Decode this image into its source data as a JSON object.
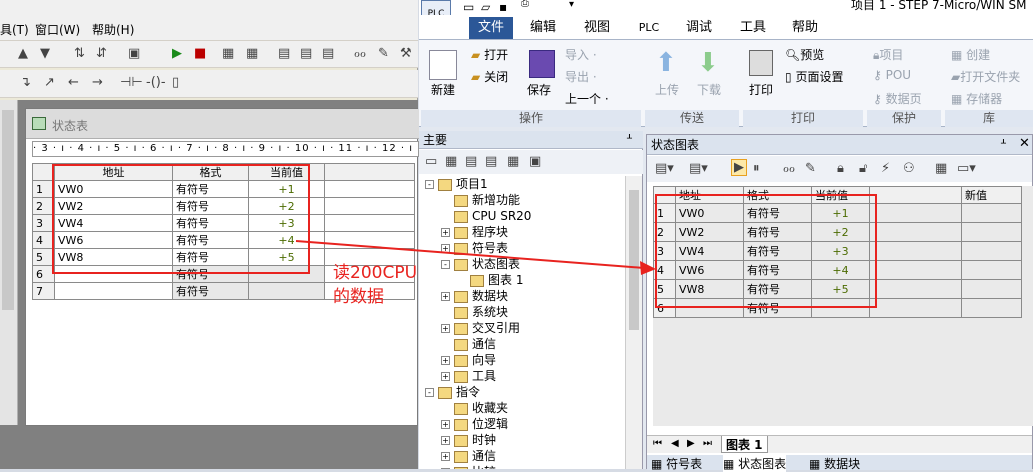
{
  "left_app": {
    "menu": [
      "具(T)",
      "窗口(W)",
      "帮助(H)"
    ],
    "window_title": "状态表",
    "ruler": "· 3 · ı · 4 · ı · 5 · ı · 6 · ı · 7 · ı · 8 · ı · 9 · ı · 10 · ı · 11 · ı · 12 · ı",
    "columns": [
      "",
      "地址",
      "格式",
      "当前值"
    ],
    "rows": [
      {
        "num": "1",
        "address": "VW0",
        "format": "有符号",
        "value": "+1"
      },
      {
        "num": "2",
        "address": "VW2",
        "format": "有符号",
        "value": "+2"
      },
      {
        "num": "3",
        "address": "VW4",
        "format": "有符号",
        "value": "+3"
      },
      {
        "num": "4",
        "address": "VW6",
        "format": "有符号",
        "value": "+4"
      },
      {
        "num": "5",
        "address": "VW8",
        "format": "有符号",
        "value": "+5"
      },
      {
        "num": "6",
        "address": "",
        "format": "有符号",
        "value": ""
      },
      {
        "num": "7",
        "address": "",
        "format": "有符号",
        "value": ""
      }
    ]
  },
  "annotation": {
    "line1": "读200CPU",
    "line2": "的数据"
  },
  "right_app": {
    "title": "项目 1 - STEP 7-Micro/WIN SM",
    "tabs": [
      "文件",
      "编辑",
      "视图",
      "PLC",
      "调试",
      "工具",
      "帮助"
    ],
    "ribbon": {
      "new": "新建",
      "open": "打开",
      "close": "关闭",
      "save": "保存",
      "import": "导入 ·",
      "export": "导出 ·",
      "prev": "上一个 ·",
      "upload": "上传",
      "download": "下载",
      "print": "打印",
      "preview": "预览",
      "page_setup": "页面设置",
      "project": "项目",
      "pou": "POU",
      "data_page": "数据页",
      "create": "创建",
      "open_folder": "打开文件夹",
      "storage": "存储器",
      "groups": [
        "操作",
        "传送",
        "打印",
        "保护",
        "库"
      ]
    },
    "tree": {
      "title": "主要",
      "items": [
        {
          "label": "项目1",
          "level": 0,
          "expand": "-"
        },
        {
          "label": "新增功能",
          "level": 1,
          "expand": ""
        },
        {
          "label": "CPU SR20",
          "level": 1,
          "expand": ""
        },
        {
          "label": "程序块",
          "level": 1,
          "expand": "+"
        },
        {
          "label": "符号表",
          "level": 1,
          "expand": "+"
        },
        {
          "label": "状态图表",
          "level": 1,
          "expand": "-"
        },
        {
          "label": "图表 1",
          "level": 2,
          "expand": ""
        },
        {
          "label": "数据块",
          "level": 1,
          "expand": "+"
        },
        {
          "label": "系统块",
          "level": 1,
          "expand": ""
        },
        {
          "label": "交叉引用",
          "level": 1,
          "expand": "+"
        },
        {
          "label": "通信",
          "level": 1,
          "expand": ""
        },
        {
          "label": "向导",
          "level": 1,
          "expand": "+"
        },
        {
          "label": "工具",
          "level": 1,
          "expand": "+"
        },
        {
          "label": "指令",
          "level": 0,
          "expand": "-"
        },
        {
          "label": "收藏夹",
          "level": 1,
          "expand": ""
        },
        {
          "label": "位逻辑",
          "level": 1,
          "expand": "+"
        },
        {
          "label": "时钟",
          "level": 1,
          "expand": "+"
        },
        {
          "label": "通信",
          "level": 1,
          "expand": "+"
        },
        {
          "label": "比较",
          "level": 1,
          "expand": "+"
        }
      ]
    },
    "chart": {
      "title": "状态图表",
      "columns": [
        "",
        "地址",
        "格式",
        "当前值",
        "新值"
      ],
      "rows": [
        {
          "num": "1",
          "address": "VW0",
          "format": "有符号",
          "value": "+1"
        },
        {
          "num": "2",
          "address": "VW2",
          "format": "有符号",
          "value": "+2"
        },
        {
          "num": "3",
          "address": "VW4",
          "format": "有符号",
          "value": "+3"
        },
        {
          "num": "4",
          "address": "VW6",
          "format": "有符号",
          "value": "+4"
        },
        {
          "num": "5",
          "address": "VW8",
          "format": "有符号",
          "value": "+5"
        },
        {
          "num": "6",
          "address": "",
          "format": "有符号",
          "value": ""
        }
      ],
      "sheet_tab": "图表 1",
      "bottom_tabs": [
        "符号表",
        "状态图表",
        "数据块"
      ]
    }
  },
  "colors": {
    "annotation": "#e8231f",
    "value": "#4b6b00",
    "accent": "#2b5797"
  }
}
